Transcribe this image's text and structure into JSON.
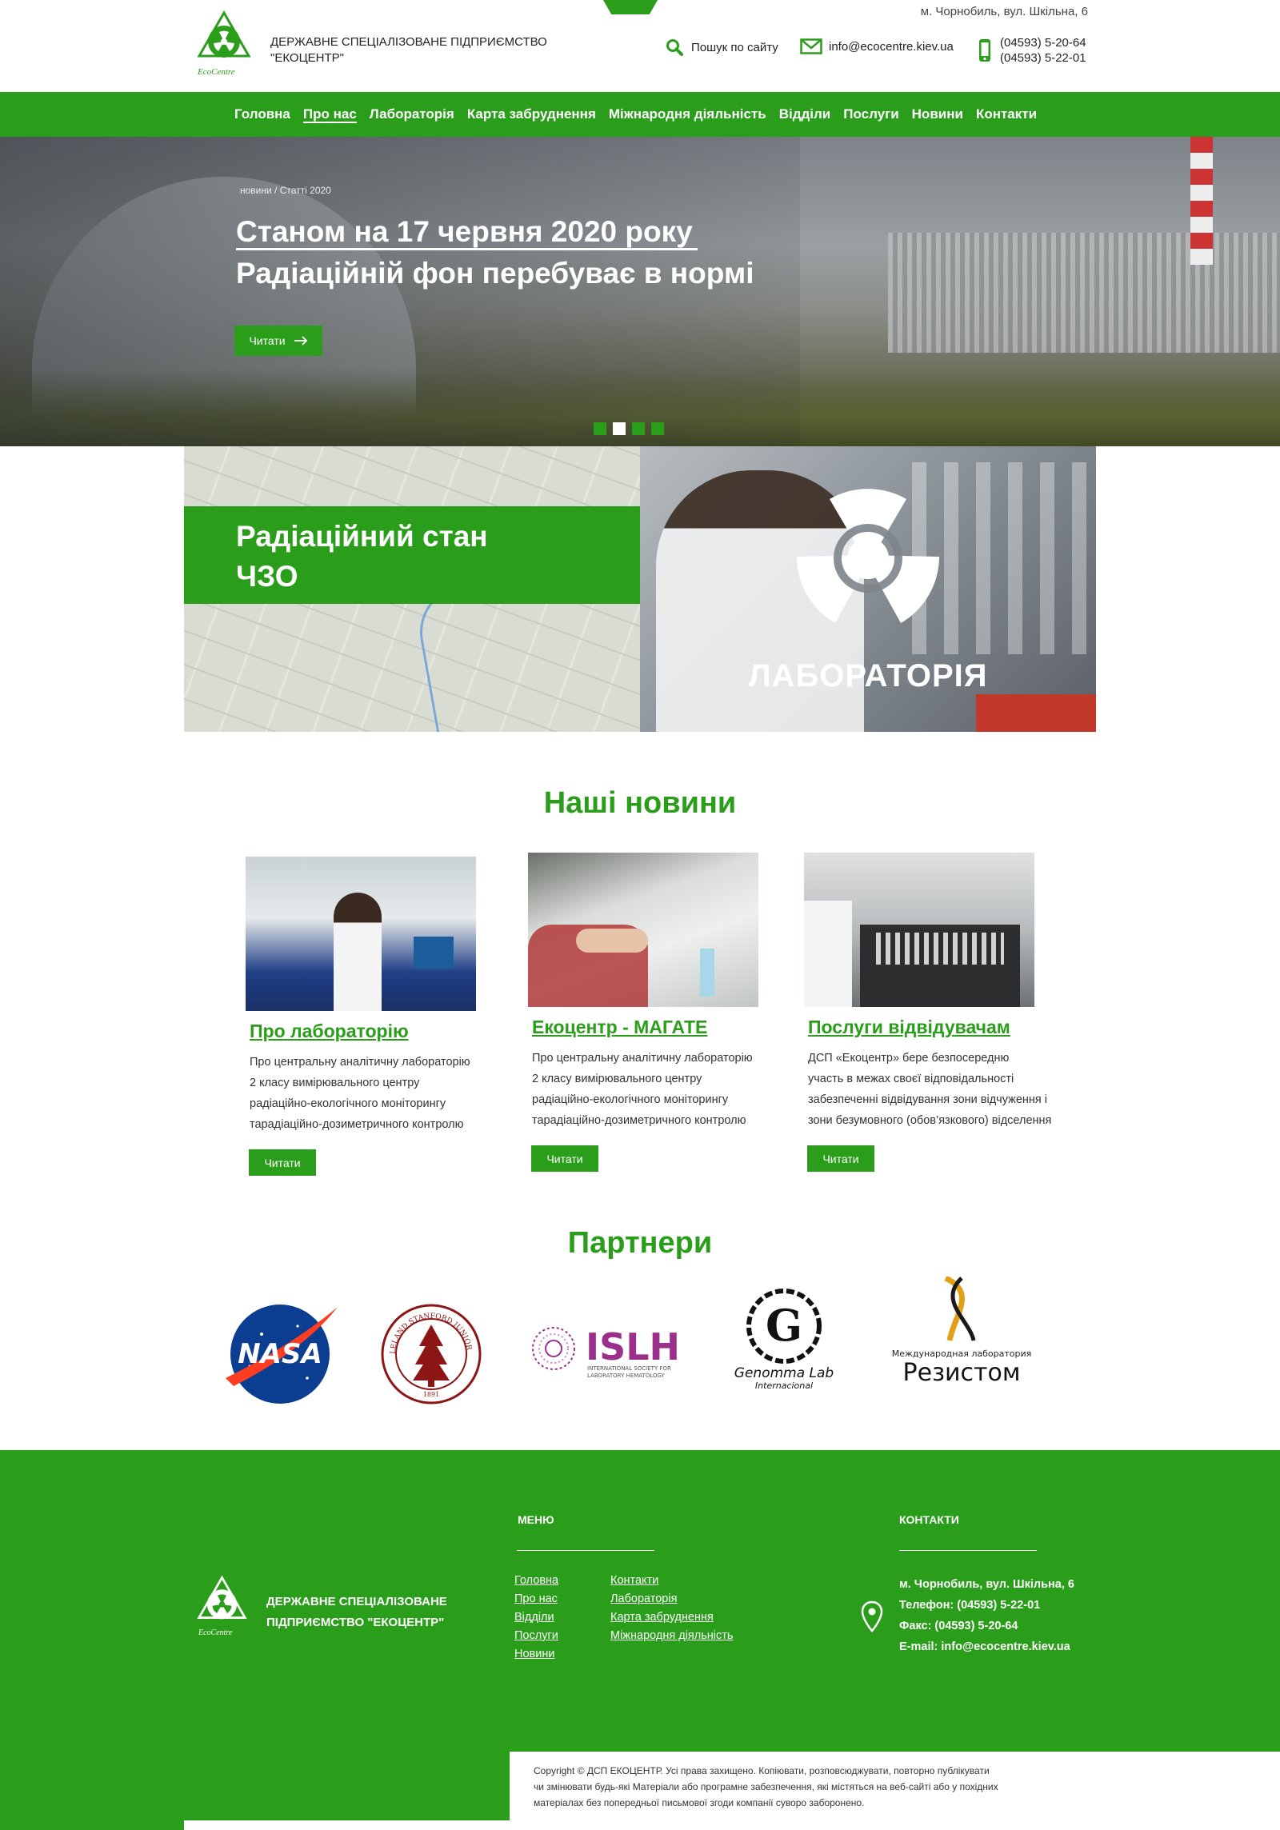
{
  "header": {
    "company_line1": "ДЕРЖАВНЕ СПЕЦІАЛІЗОВАНЕ ПІДПРИЄМСТВО",
    "company_line2": "\"ЕКОЦЕНТР\"",
    "logo_text": "EcoCentre",
    "address": "м. Чорнобиль, вул. Шкільна, 6",
    "search_label": "Пошук по сайту",
    "email": "info@ecocentre.kiev.ua",
    "phone1": "(04593) 5-20-64",
    "phone2": "(04593) 5-22-01"
  },
  "nav": {
    "items": [
      "Головна",
      "Про нас",
      "Лабораторія",
      "Карта забруднення",
      "Міжнародня діяльність",
      "Відділи",
      "Послуги",
      "Новини",
      "Контакти"
    ],
    "active_index": 1
  },
  "hero": {
    "breadcrumb": "новини  / Статті  2020",
    "title_line1": "Станом на 17 червня 2020 року",
    "title_line2": "Радіаційній фон перебуває в нормі",
    "read_label": "Читати",
    "slides": 4,
    "active_slide": 1
  },
  "tiles": {
    "map_title_line1": "Радіаційний стан",
    "map_title_line2": "ЧЗО",
    "lab_title": "ЛАБОРАТОРІЯ"
  },
  "news": {
    "title": "Наші новини",
    "items": [
      {
        "title": "Про лабораторію",
        "lines": [
          "Про центральну аналітичну лабораторію",
          "2 класу вимірювального центру",
          "радіаційно-екологічного моніторингу",
          "тарадіаційно-дозиметричного контролю"
        ],
        "button": "Читати"
      },
      {
        "title": "Екоцентр -   МАГАТЕ",
        "lines": [
          "Про центральну аналітичну лабораторію",
          "2 класу вимірювального центру",
          "радіаційно-екологічного моніторингу",
          "тарадіаційно-дозиметричного контролю"
        ],
        "button": "Читати"
      },
      {
        "title": "Послуги відвідувачам",
        "lines": [
          "ДСП «Екоцентр» бере безпосереднюучасть в межах своєї відповідальностізабезпеченні відвідування зони відчуження і зони безумовного (обов’язкового) відселення"
        ],
        "button": "Читати"
      }
    ]
  },
  "partners": {
    "title": "Партнери",
    "logos": {
      "nasa": "NASA",
      "stanford": "LELAND STANFORD JUNIOR UNIVERSITY",
      "stanford_year": "1891",
      "islh": "ISLH",
      "islh_sub1": "INTERNATIONAL SOCIETY FOR",
      "islh_sub2": "LABORATORY HEMATOLOGY",
      "genomma1": "Genomma Lab",
      "genomma2": "Internacional",
      "rezistom_sub": "Международная лаборатория",
      "rezistom": "Резистом"
    }
  },
  "footer": {
    "company_line1": "ДЕРЖАВНЕ СПЕЦІАЛІЗОВАНЕ",
    "company_line2": "ПІДПРИЄМСТВО  \"ЕКОЦЕНТР\"",
    "menu_heading": "МЕНЮ",
    "contacts_heading": "КОНТАКТИ",
    "menu_col1": [
      "Головна",
      "Про нас",
      "Відділи",
      "Послуги",
      "Новини"
    ],
    "menu_col2": [
      "Контакти",
      "Лабораторія",
      "Карта забруднення",
      "Міжнародня діяльність "
    ],
    "address": "м. Чорнобиль, вул. Шкільна, 6",
    "phone": "Телефон: (04593) 5-22-01",
    "fax": "Факс: (04593) 5-20-64",
    "email": "E-mail: info@ecocentre.kiev.ua",
    "copyright_lines": [
      "Copyright © ДСП ЕКОЦЕНТР. Усі права захищено. Копіювати, розповсюджувати, повторно публікувати",
      "чи змінювати будь-які Матеріали або програмне забезпечення, які містяться на веб-сайті  або у похідних",
      "матеріалах без попередньої письмової згоди компанії  суворо заборонено."
    ]
  },
  "colors": {
    "brand_green": "#2a9d1a",
    "white": "#ffffff"
  }
}
